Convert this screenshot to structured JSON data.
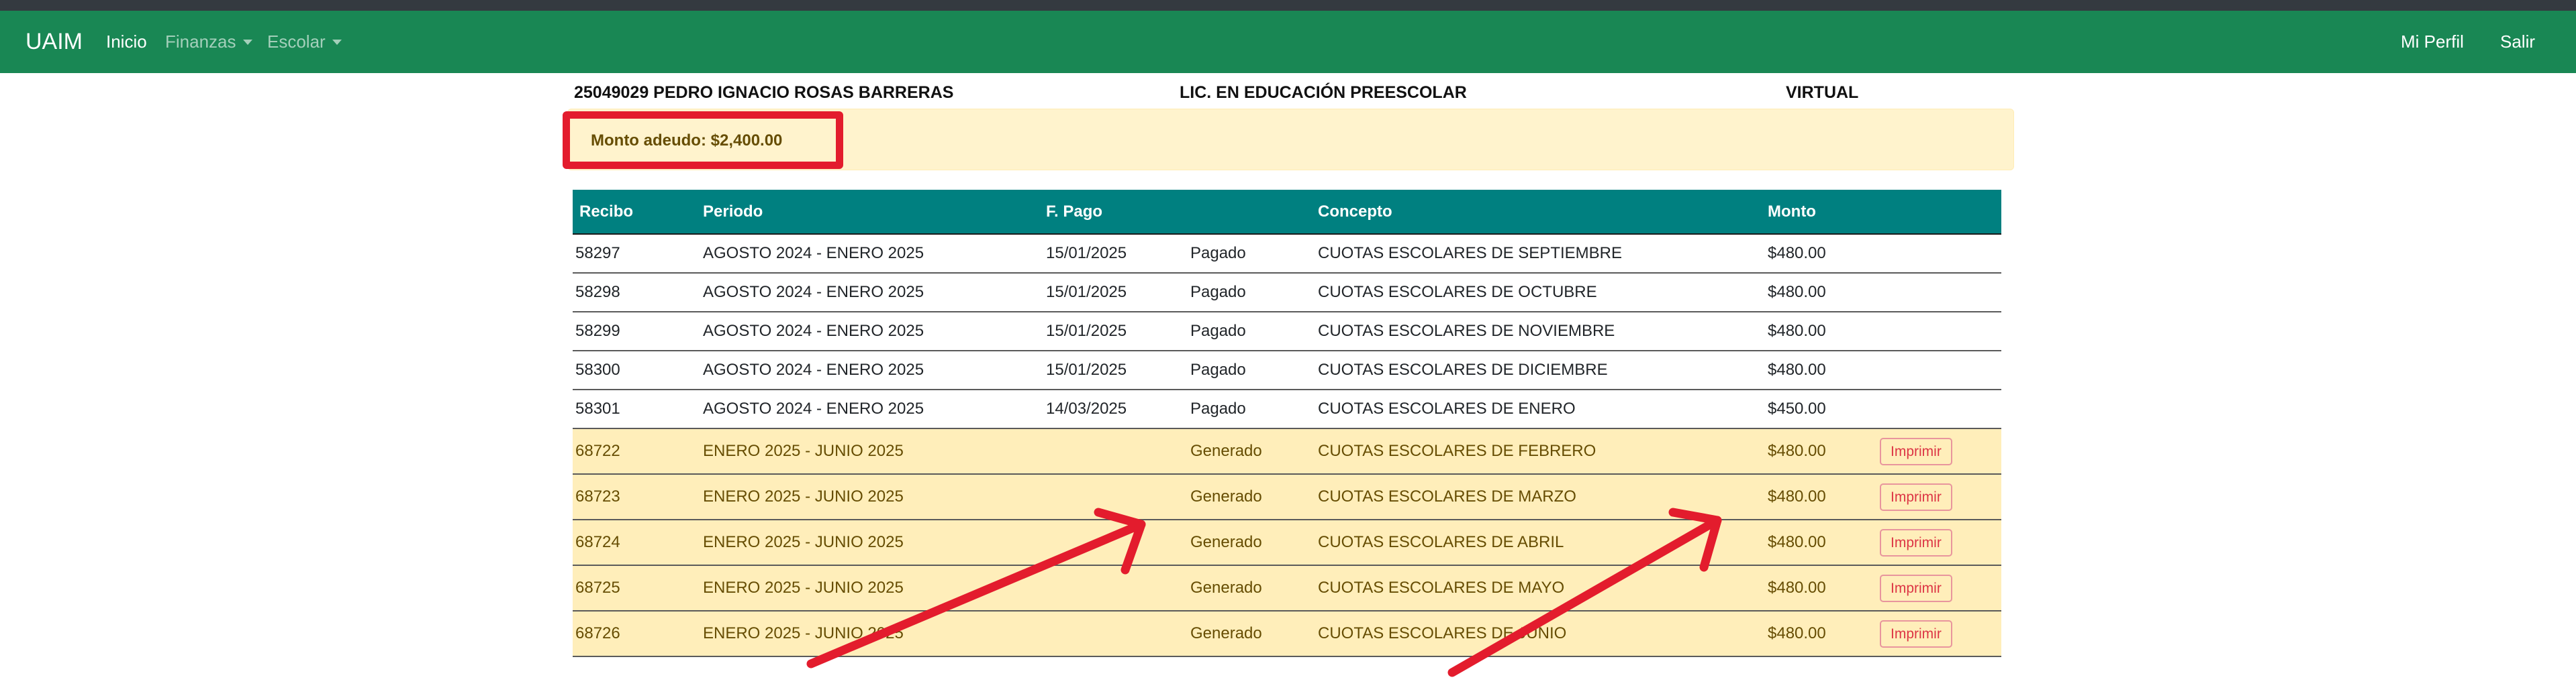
{
  "navbar": {
    "brand": "UAIM",
    "items": [
      {
        "label": "Inicio"
      },
      {
        "label": "Finanzas"
      },
      {
        "label": "Escolar"
      }
    ],
    "right_items": [
      {
        "label": "Mi Perfil"
      },
      {
        "label": "Salir"
      }
    ],
    "bg_color": "#198754"
  },
  "student": {
    "id_name": "25049029 PEDRO IGNACIO ROSAS BARRERAS",
    "program": "LIC. EN EDUCACIÓN PREESCOLAR",
    "modality": "VIRTUAL"
  },
  "alert": {
    "text": "Monto adeudo: $2,400.00"
  },
  "table": {
    "header_color": "#008080",
    "columns": [
      "Recibo",
      "Periodo",
      "F. Pago",
      "",
      "Concepto",
      "Monto",
      ""
    ],
    "rows": [
      {
        "recibo": "58297",
        "periodo": "AGOSTO 2024 - ENERO 2025",
        "fecha": "15/01/2025",
        "estado": "Pagado",
        "concepto": "CUOTAS ESCOLARES DE SEPTIEMBRE",
        "monto": "$480.00",
        "action": ""
      },
      {
        "recibo": "58298",
        "periodo": "AGOSTO 2024 - ENERO 2025",
        "fecha": "15/01/2025",
        "estado": "Pagado",
        "concepto": "CUOTAS ESCOLARES DE OCTUBRE",
        "monto": "$480.00",
        "action": ""
      },
      {
        "recibo": "58299",
        "periodo": "AGOSTO 2024 - ENERO 2025",
        "fecha": "15/01/2025",
        "estado": "Pagado",
        "concepto": "CUOTAS ESCOLARES DE NOVIEMBRE",
        "monto": "$480.00",
        "action": ""
      },
      {
        "recibo": "58300",
        "periodo": "AGOSTO 2024 - ENERO 2025",
        "fecha": "15/01/2025",
        "estado": "Pagado",
        "concepto": "CUOTAS ESCOLARES DE DICIEMBRE",
        "monto": "$480.00",
        "action": ""
      },
      {
        "recibo": "58301",
        "periodo": "AGOSTO 2024 - ENERO 2025",
        "fecha": "14/03/2025",
        "estado": "Pagado",
        "concepto": "CUOTAS ESCOLARES DE ENERO",
        "monto": "$450.00",
        "action": ""
      },
      {
        "recibo": "68722",
        "periodo": "ENERO 2025 - JUNIO 2025",
        "fecha": "",
        "estado": "Generado",
        "concepto": "CUOTAS ESCOLARES DE FEBRERO",
        "monto": "$480.00",
        "action": "Imprimir"
      },
      {
        "recibo": "68723",
        "periodo": "ENERO 2025 - JUNIO 2025",
        "fecha": "",
        "estado": "Generado",
        "concepto": "CUOTAS ESCOLARES DE MARZO",
        "monto": "$480.00",
        "action": "Imprimir"
      },
      {
        "recibo": "68724",
        "periodo": "ENERO 2025 - JUNIO 2025",
        "fecha": "",
        "estado": "Generado",
        "concepto": "CUOTAS ESCOLARES DE ABRIL",
        "monto": "$480.00",
        "action": "Imprimir"
      },
      {
        "recibo": "68725",
        "periodo": "ENERO 2025 - JUNIO 2025",
        "fecha": "",
        "estado": "Generado",
        "concepto": "CUOTAS ESCOLARES DE MAYO",
        "monto": "$480.00",
        "action": "Imprimir"
      },
      {
        "recibo": "68726",
        "periodo": "ENERO 2025 - JUNIO 2025",
        "fecha": "",
        "estado": "Generado",
        "concepto": "CUOTAS ESCOLARES DE JUNIO",
        "monto": "$480.00",
        "action": "Imprimir"
      }
    ]
  },
  "annotation_color": "#e31c2d"
}
